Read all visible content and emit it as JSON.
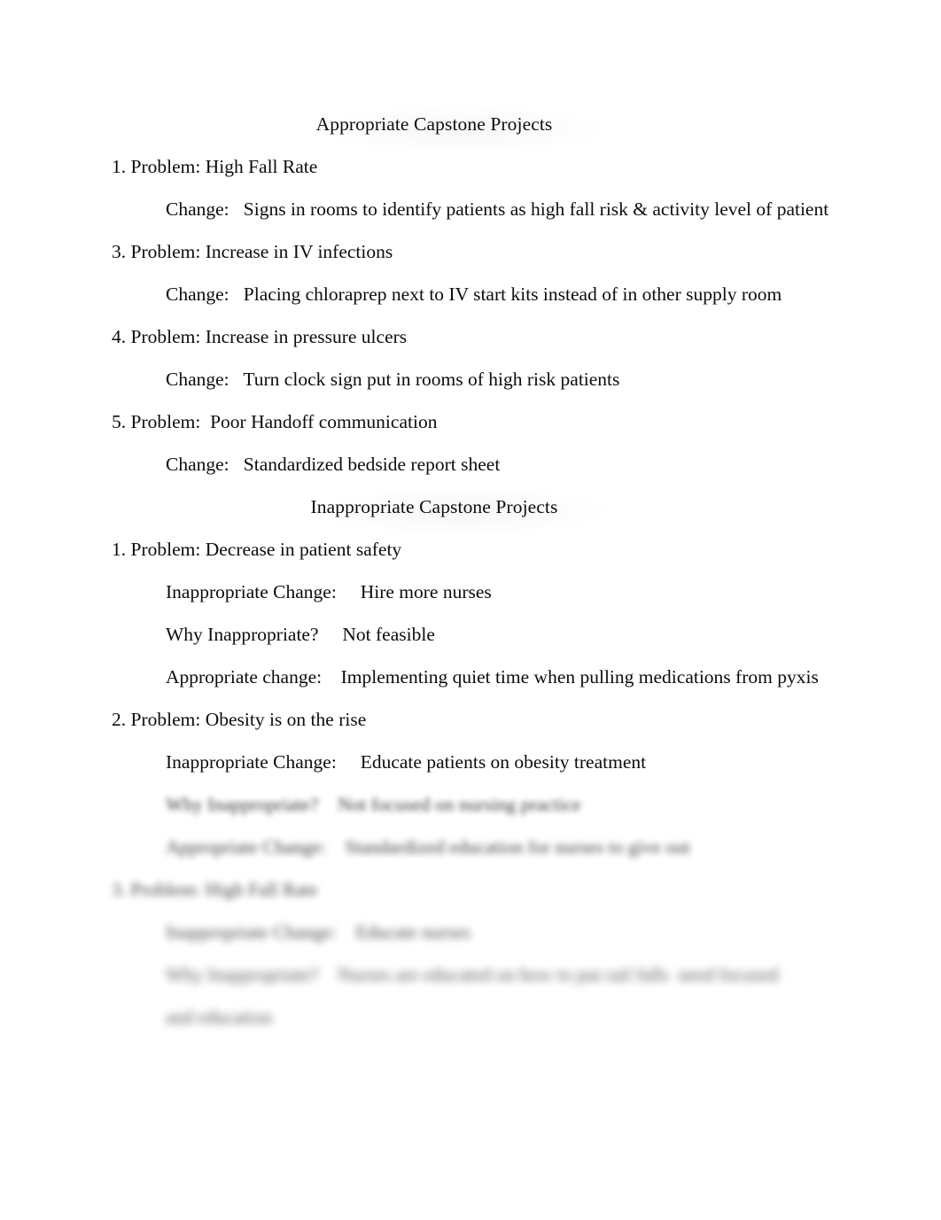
{
  "document": {
    "sections": [
      {
        "heading": "Appropriate Capstone Projects",
        "entries": [
          {
            "problem": "1. Problem: High Fall Rate",
            "lines": [
              "Change:   Signs in rooms to identify patients as high fall risk & activity level of patient"
            ]
          },
          {
            "problem": "3. Problem: Increase in IV infections",
            "lines": [
              "Change:   Placing chloraprep next to IV start kits instead of in other supply room"
            ]
          },
          {
            "problem": "4. Problem: Increase in pressure ulcers",
            "lines": [
              "Change:   Turn clock sign put in rooms of high risk patients"
            ]
          },
          {
            "problem": "5. Problem:  Poor Handoff communication",
            "lines": [
              "Change:   Standardized bedside report sheet"
            ]
          }
        ]
      },
      {
        "heading": "Inappropriate Capstone Projects",
        "entries": [
          {
            "problem": "1. Problem: Decrease in patient safety",
            "lines": [
              "Inappropriate Change:     Hire more nurses",
              "Why Inappropriate?     Not feasible",
              "Appropriate change:    Implementing quiet time when pulling medications from pyxis"
            ]
          },
          {
            "problem": "2. Problem: Obesity is on the rise",
            "lines": [
              "Inappropriate Change:     Educate patients on obesity treatment",
              "Why Inappropriate?    Not focused on nursing practice",
              "Appropriate Change:    Standardized education for nurses to give out"
            ]
          },
          {
            "problem": "3. Problem: High Fall Rate",
            "lines": [
              "Inappropriate Change:    Educate nurses",
              "Why Inappropriate?    Nurses are educated on how to put rail falls  need focused and education"
            ]
          }
        ]
      }
    ]
  }
}
